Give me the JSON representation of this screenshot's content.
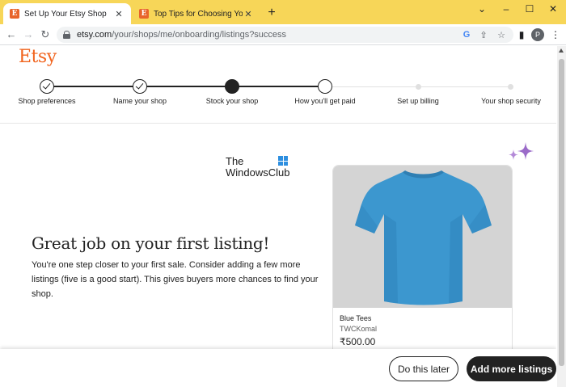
{
  "browser": {
    "tabs": [
      {
        "label": "Set Up Your Etsy Shop",
        "favicon": "E",
        "active": true
      },
      {
        "label": "Top Tips for Choosing Your Etsy",
        "favicon": "E",
        "active": false
      }
    ],
    "url_host": "etsy.com",
    "url_path": "/your/shops/me/onboarding/listings?success",
    "profile_initial": "P",
    "accent": "#f7d658"
  },
  "page": {
    "logo": "Etsy",
    "steps": [
      {
        "label": "Shop preferences",
        "state": "done"
      },
      {
        "label": "Name your shop",
        "state": "done"
      },
      {
        "label": "Stock your shop",
        "state": "current"
      },
      {
        "label": "How you'll get paid",
        "state": "next"
      },
      {
        "label": "Set up billing",
        "state": "upcoming"
      },
      {
        "label": "Your shop security",
        "state": "upcoming"
      }
    ],
    "watermark_line1": "The",
    "watermark_line2": "WindowsClub",
    "headline": "Great job on your first listing!",
    "description": "You're one step closer to your first sale. Consider adding a few more listings (five is a good start). This gives buyers more chances to find your shop.",
    "listing": {
      "title": "Blue Tees",
      "shop": "TWCKomal",
      "price": "₹500.00",
      "shirt_color": "#3c97cf"
    },
    "buttons": {
      "later": "Do this later",
      "add_more": "Add more listings"
    },
    "brand_color": "#f1641e"
  }
}
